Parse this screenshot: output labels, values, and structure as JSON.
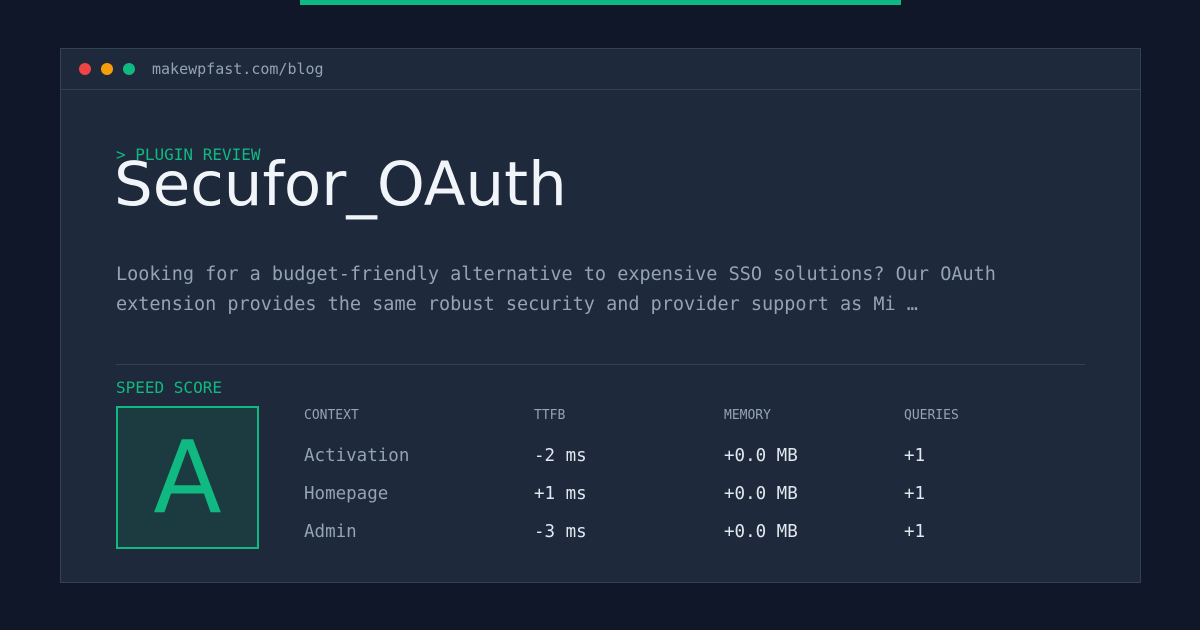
{
  "colors": {
    "accent": "#10b981",
    "warning": "#f59e0b",
    "danger": "#ef4444",
    "background": "#0f1729",
    "panel": "#1e293b",
    "border": "#334155",
    "text_muted": "#94a3b8",
    "text": "#f1f5f9"
  },
  "window": {
    "controls": [
      "close-dot",
      "minimize-dot",
      "maximize-dot"
    ],
    "url": "makewpfast.com/blog"
  },
  "article": {
    "eyebrow": "> PLUGIN REVIEW",
    "title": "Secufor_OAuth",
    "description": "Looking for a budget-friendly alternative to expensive SSO solutions? Our OAuth extension provides the same robust security and provider support as Mi …"
  },
  "speed": {
    "label": "SPEED SCORE",
    "grade": "A"
  },
  "metrics": {
    "headers": [
      "CONTEXT",
      "TTFB",
      "MEMORY",
      "QUERIES"
    ],
    "rows": [
      {
        "context": "Activation",
        "ttfb": "-2 ms",
        "memory": "+0.0 MB",
        "queries": "+1"
      },
      {
        "context": "Homepage",
        "ttfb": "+1 ms",
        "memory": "+0.0 MB",
        "queries": "+1"
      },
      {
        "context": "Admin",
        "ttfb": "-3 ms",
        "memory": "+0.0 MB",
        "queries": "+1"
      }
    ]
  }
}
